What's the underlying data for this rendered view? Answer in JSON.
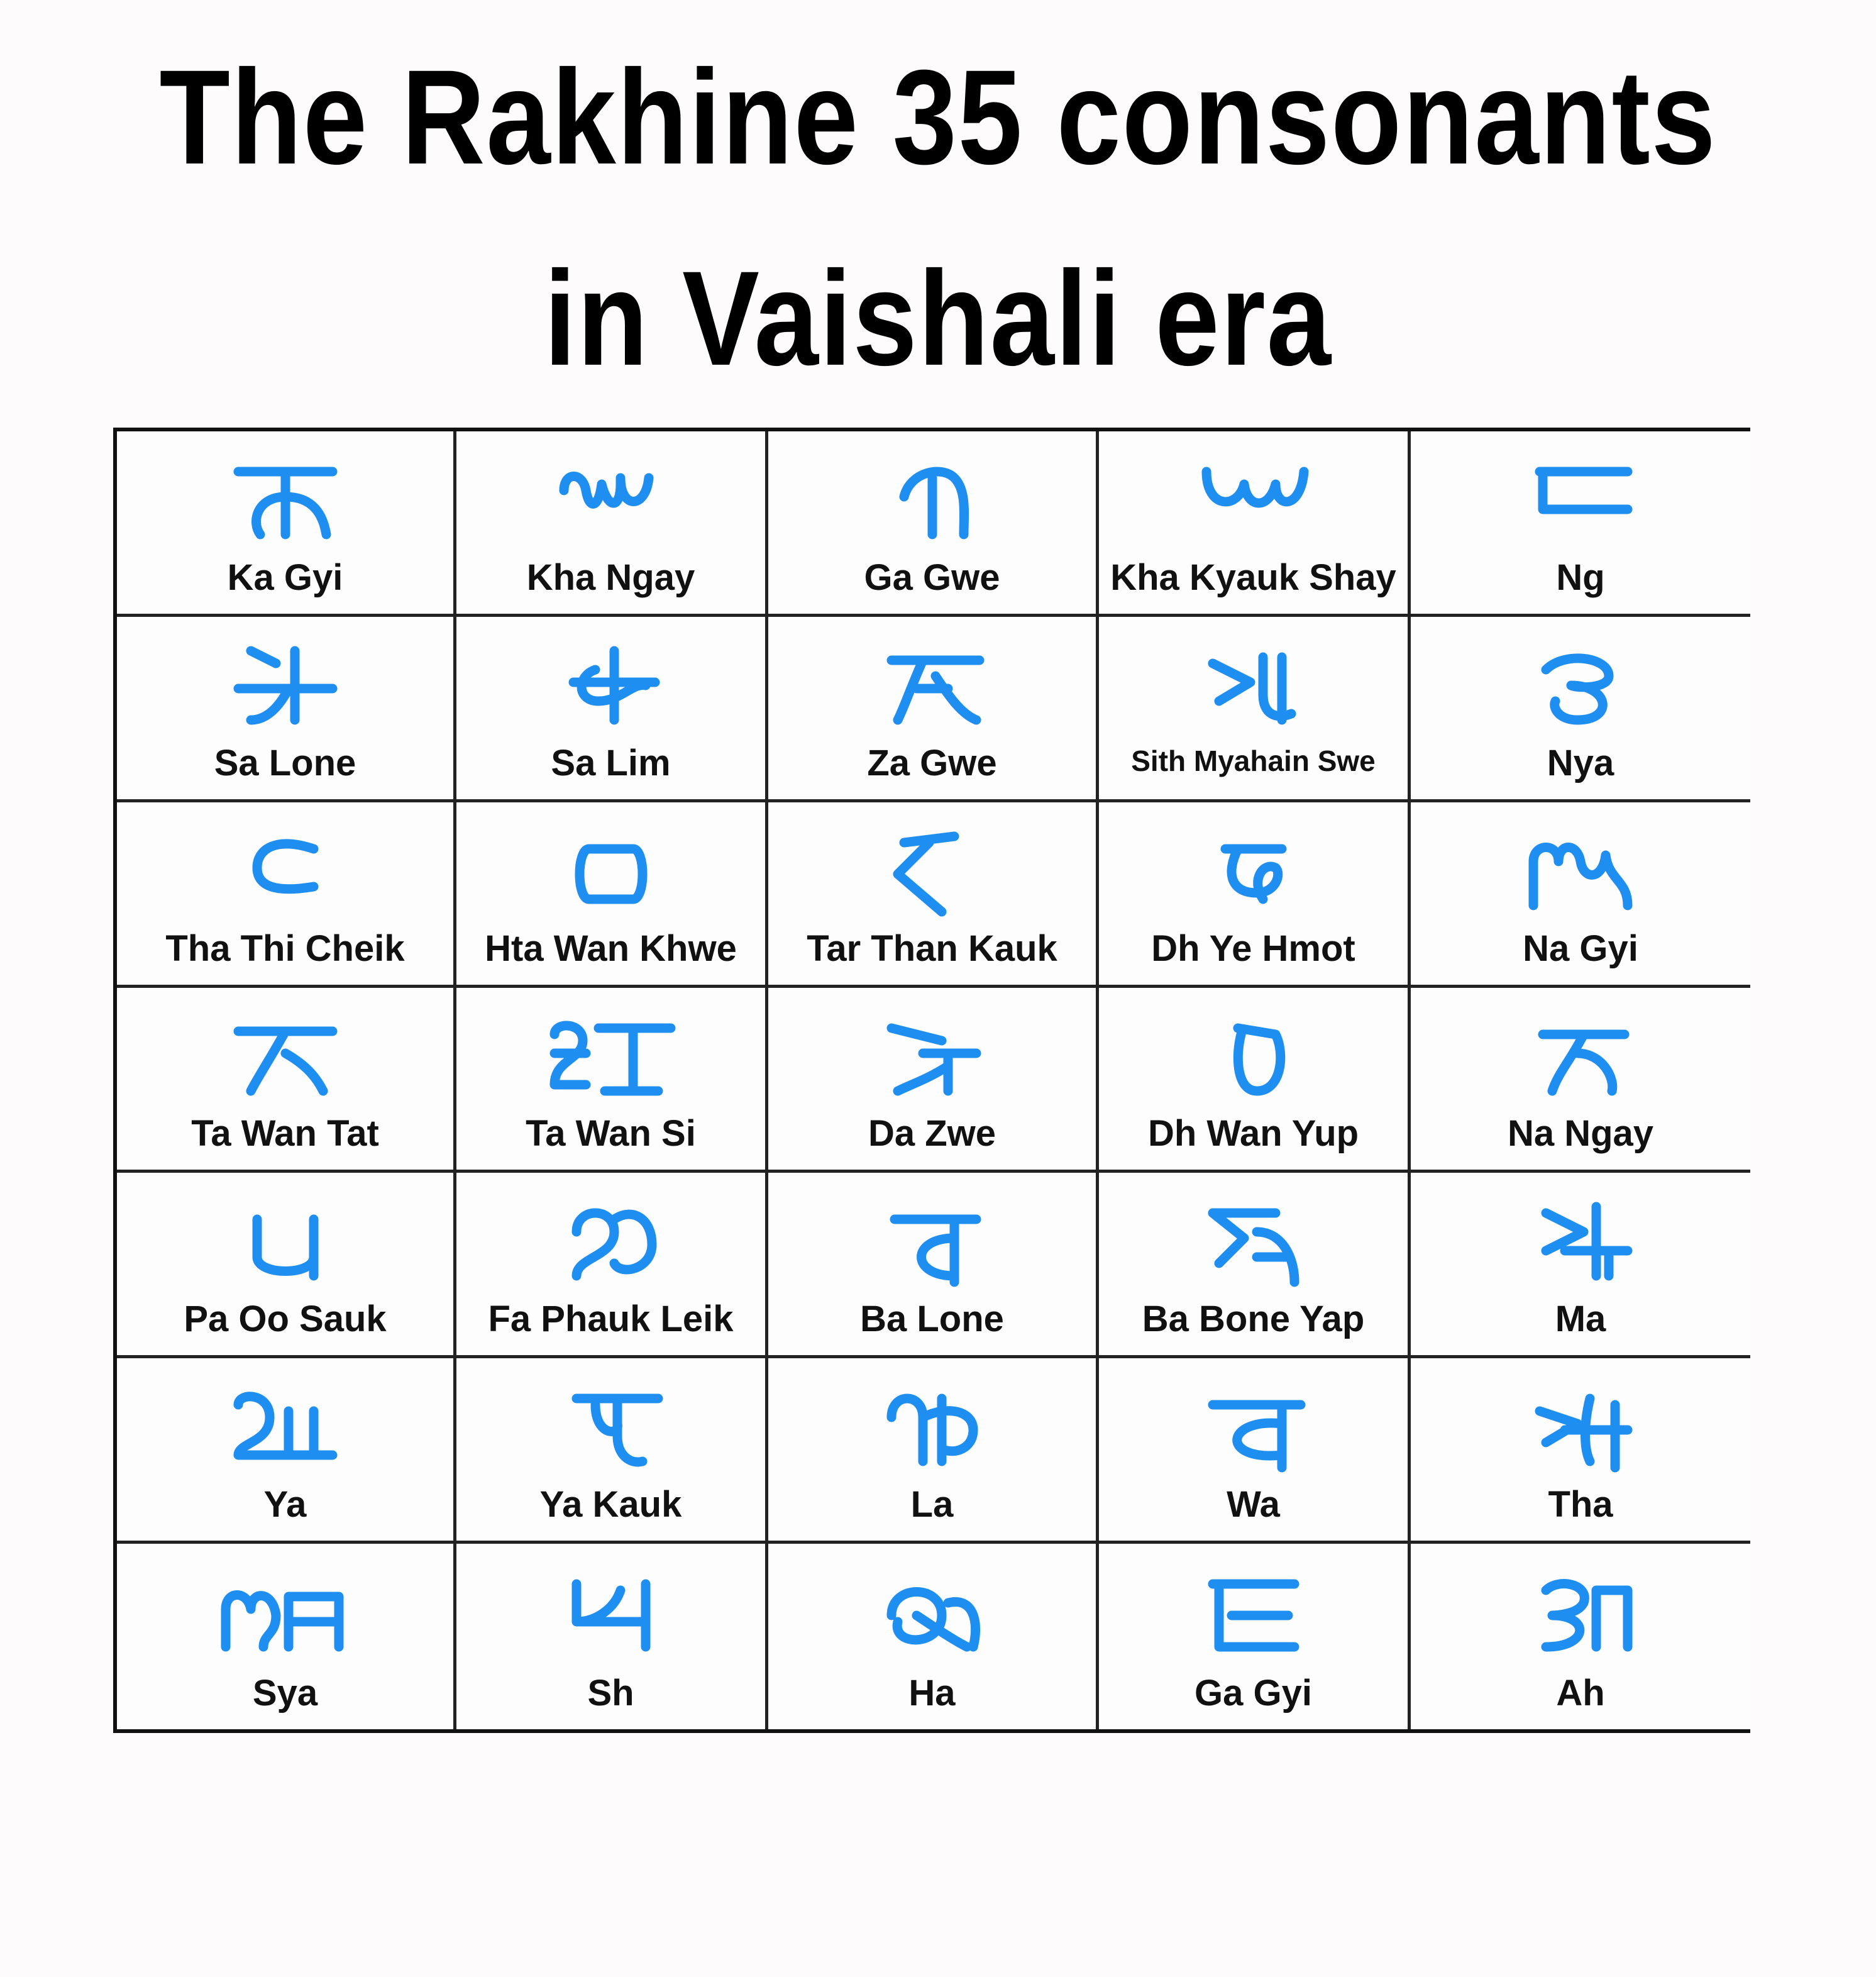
{
  "title_line1": "The Rakhine 35 consonants",
  "title_line2": "in Vaishali era",
  "glyph_color": "#1e8ff0",
  "consonants": [
    {
      "label": "Ka Gyi"
    },
    {
      "label": "Kha Ngay"
    },
    {
      "label": "Ga Gwe"
    },
    {
      "label": "Kha Kyauk Shay"
    },
    {
      "label": "Ng"
    },
    {
      "label": "Sa Lone"
    },
    {
      "label": "Sa Lim"
    },
    {
      "label": "Za Gwe"
    },
    {
      "label": "Sith Myahain Swe"
    },
    {
      "label": "Nya"
    },
    {
      "label": "Tha Thi Cheik"
    },
    {
      "label": "Hta Wan Khwe"
    },
    {
      "label": "Tar Than Kauk"
    },
    {
      "label": "Dh Ye Hmot"
    },
    {
      "label": "Na Gyi"
    },
    {
      "label": "Ta Wan Tat"
    },
    {
      "label": "Ta Wan Si"
    },
    {
      "label": "Da Zwe"
    },
    {
      "label": "Dh Wan Yup"
    },
    {
      "label": "Na Ngay"
    },
    {
      "label": "Pa Oo Sauk"
    },
    {
      "label": "Fa Phauk Leik"
    },
    {
      "label": "Ba Lone"
    },
    {
      "label": "Ba Bone Yap"
    },
    {
      "label": "Ma"
    },
    {
      "label": "Ya"
    },
    {
      "label": "Ya Kauk"
    },
    {
      "label": "La"
    },
    {
      "label": "Wa"
    },
    {
      "label": "Tha"
    },
    {
      "label": "Sya"
    },
    {
      "label": "Sh"
    },
    {
      "label": "Ha"
    },
    {
      "label": "Ga Gyi"
    },
    {
      "label": "Ah"
    }
  ]
}
